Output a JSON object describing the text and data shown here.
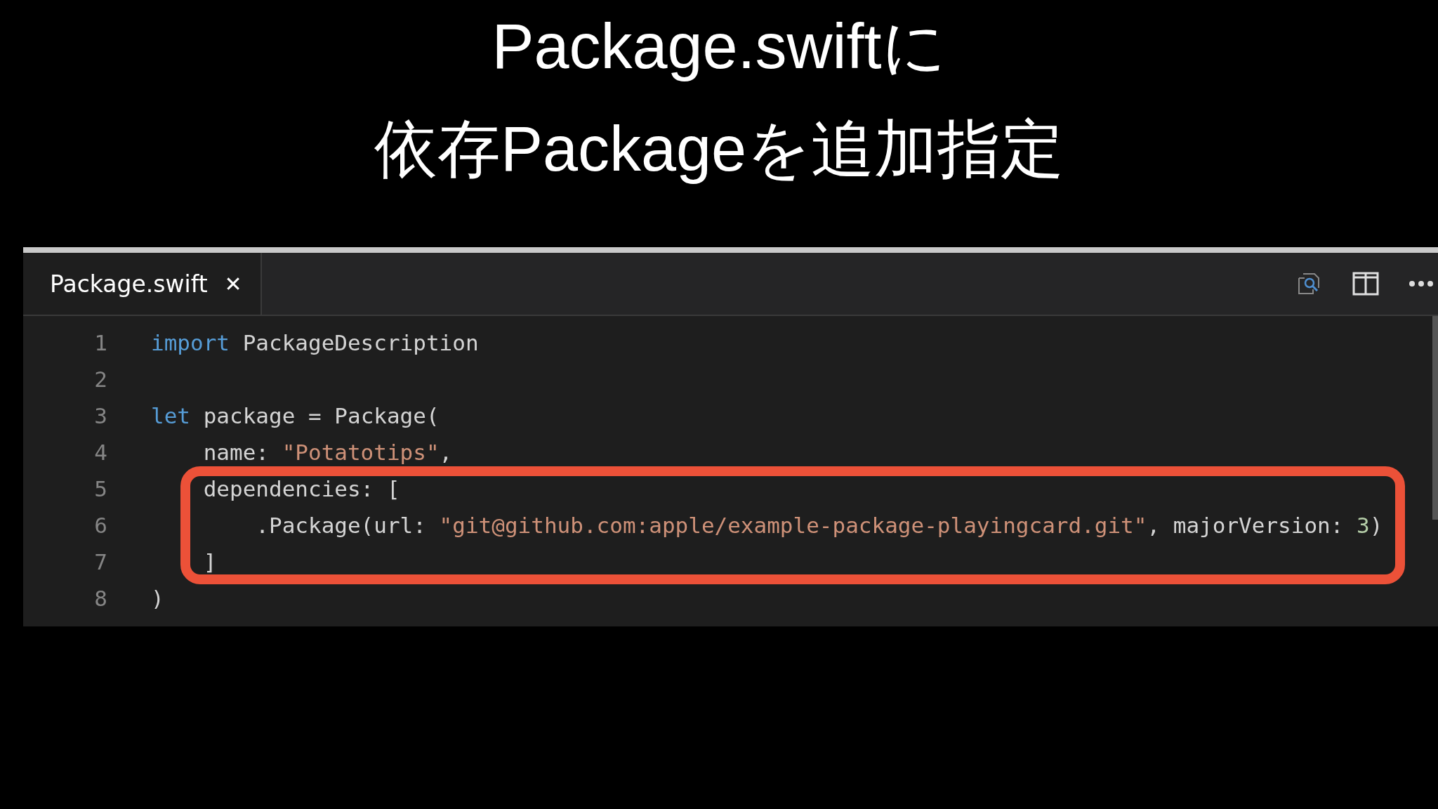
{
  "slide_title": [
    "Package.swiftに",
    "依存Packageを追加指定"
  ],
  "editor": {
    "tabs": [
      {
        "label": "Package.swift",
        "close": "✕",
        "selected": true
      }
    ],
    "lines": [
      {
        "number": "1",
        "tokens": [
          {
            "kind": "keyword",
            "text": "import"
          },
          {
            "kind": "plain",
            "text": " PackageDescription"
          }
        ]
      },
      {
        "number": "2"
      },
      {
        "number": "3",
        "tokens": [
          {
            "kind": "keyword",
            "text": "let"
          },
          {
            "kind": "plain",
            "text": " package = Package("
          }
        ]
      },
      {
        "number": "4",
        "tokens": [
          {
            "kind": "plain",
            "text": "    name: "
          },
          {
            "kind": "string",
            "text": "\"Potatotips\""
          },
          {
            "kind": "plain",
            "text": ","
          }
        ]
      },
      {
        "number": "5",
        "tokens": [
          {
            "kind": "plain",
            "text": "    dependencies: ["
          }
        ]
      },
      {
        "number": "6",
        "tokens": [
          {
            "kind": "plain",
            "text": "        .Package(url: "
          },
          {
            "kind": "string",
            "text": "\"git@github.com:apple/example-package-playingcard.git\""
          },
          {
            "kind": "plain",
            "text": ", majorVersion: "
          },
          {
            "kind": "number",
            "text": "3"
          },
          {
            "kind": "plain",
            "text": ")"
          }
        ]
      },
      {
        "number": "7",
        "tokens": [
          {
            "kind": "plain",
            "text": "    ]"
          }
        ]
      },
      {
        "number": "8",
        "tokens": [
          {
            "kind": "plain",
            "text": ")"
          }
        ]
      }
    ]
  }
}
